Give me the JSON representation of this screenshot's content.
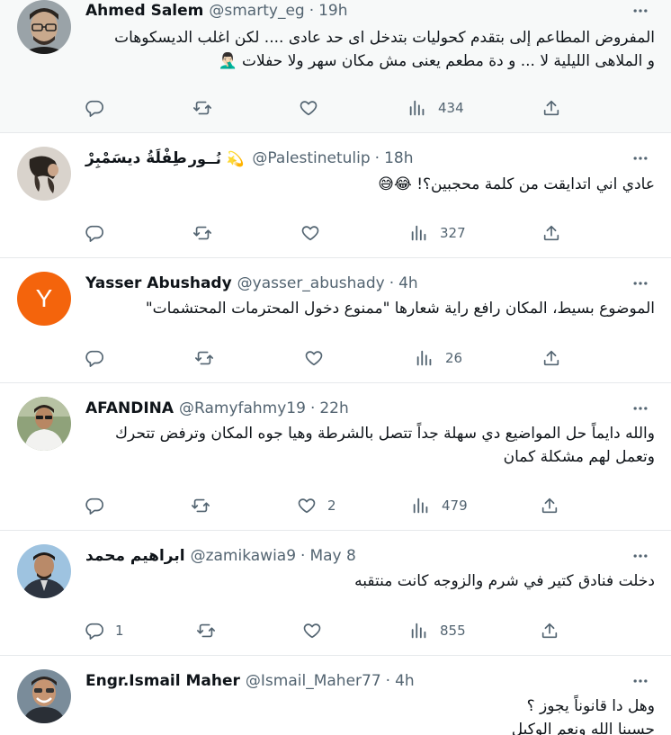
{
  "tweets": [
    {
      "name": "Ahmed Salem",
      "badge": "",
      "handle": "@smarty_eg",
      "time": "19h",
      "lines": [
        "المفروض المطاعم إلى بتقدم كحوليات بتدخل اى حد عادى .... لكن اغلب الديسكوهات",
        "و الملاهى الليلية لا ... و دة مطعم يعنى مش مكان سهر ولا حفلات 🤦🏻‍♂️"
      ],
      "replies": "",
      "retweets": "",
      "likes": "",
      "views": "434",
      "avatar": "glasses-man",
      "avatar_color": "#c9a98d"
    },
    {
      "name": "طِفْلَةُ ديسَمْبِرْ",
      "badge": "نُــور 💫",
      "handle": "@Palestinetulip",
      "time": "18h",
      "lines": [
        "عادي اني اتدايقت من كلمة محجبين؟! 😂😅"
      ],
      "replies": "",
      "retweets": "",
      "likes": "",
      "views": "327",
      "avatar": "photo-girl",
      "avatar_color": "#d9d3cc"
    },
    {
      "name": "Yasser Abushady",
      "badge": "",
      "handle": "@yasser_abushady",
      "time": "4h",
      "lines": [
        "الموضوع بسيط، المكان رافع راية شعارها \"ممنوع دخول المحترمات المحتشمات\""
      ],
      "replies": "",
      "retweets": "",
      "likes": "",
      "views": "26",
      "avatar": "letter-y",
      "avatar_letter": "Y",
      "avatar_color": "#f4640c"
    },
    {
      "name": "AFANDINA",
      "badge": "",
      "handle": "@Ramyfahmy19",
      "time": "22h",
      "lines": [
        "والله دايماً حل المواضيع دي سهلة جداً تتصل بالشرطة وهيا جوه المكان وترفض تتحرك",
        "وتعمل لهم مشكلة كمان"
      ],
      "replies": "",
      "retweets": "",
      "likes": "2",
      "views": "479",
      "avatar": "man-white-shirt",
      "avatar_color": "#8fa27a"
    },
    {
      "name": "ابراهيم محمد",
      "badge": "",
      "handle": "@zamikawia9",
      "time": "May 8",
      "lines": [
        "دخلت فنادق كتير في شرم والزوجه كانت منتقبه"
      ],
      "replies": "1",
      "retweets": "",
      "likes": "",
      "views": "855",
      "avatar": "man-blue-bg",
      "avatar_color": "#9ec3e0"
    },
    {
      "name": "Engr.Ismail Maher",
      "badge": "",
      "handle": "@Ismail_Maher77",
      "time": "4h",
      "lines": [
        "وهل دا قانوناً يجوز ؟",
        "حسبنا الله ونعم الوكيل"
      ],
      "replies": "",
      "retweets": "",
      "likes": "",
      "views": "",
      "avatar": "smiling-man",
      "avatar_color": "#7a8c9a"
    }
  ],
  "ui": {
    "separator": "·"
  },
  "colors": {
    "secondary_text": "#536471",
    "icon": "#536471",
    "highlight_bg": "#f7f9f9"
  }
}
